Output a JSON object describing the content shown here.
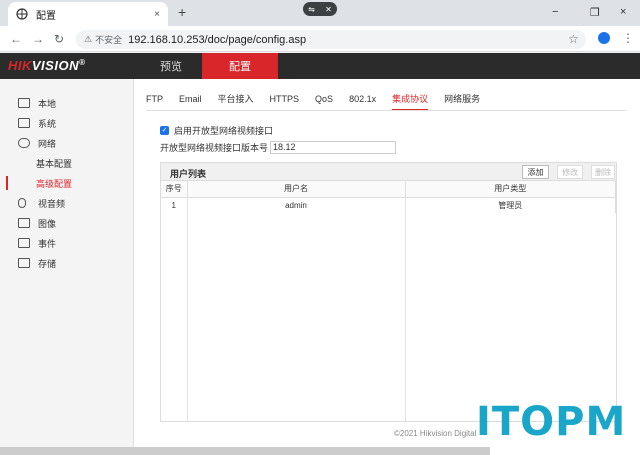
{
  "browser": {
    "tab_title": "配置",
    "tab_close": "×",
    "new_tab": "+",
    "window_minimize": "−",
    "window_restore": "❐",
    "window_close": "×",
    "insecure_label": "不安全",
    "url": "192.168.10.253/doc/page/config.asp"
  },
  "header": {
    "logo_hik": "HIK",
    "logo_vision": "VISION",
    "logo_reg": "®",
    "nav_preview": "预览",
    "nav_config": "配置"
  },
  "sidebar": {
    "items": [
      {
        "label": "本地",
        "icon": "monitor-icon"
      },
      {
        "label": "系统",
        "icon": "system-icon"
      },
      {
        "label": "网络",
        "icon": "globe-icon"
      },
      {
        "label": "基本配置"
      },
      {
        "label": "高级配置"
      },
      {
        "label": "视音频",
        "icon": "mic-icon"
      },
      {
        "label": "图像",
        "icon": "image-icon"
      },
      {
        "label": "事件",
        "icon": "event-icon"
      },
      {
        "label": "存储",
        "icon": "storage-icon"
      }
    ]
  },
  "tabs": [
    "FTP",
    "Email",
    "平台接入",
    "HTTPS",
    "QoS",
    "802.1x",
    "集成协议",
    "网络服务"
  ],
  "active_tab": "集成协议",
  "form": {
    "enable_label": "启用开放型网络视频接口",
    "enable_checked": true,
    "version_label": "开放型网络视频接口版本号",
    "version_value": "18.12"
  },
  "users": {
    "title": "用户列表",
    "add": "添加",
    "modify": "修改",
    "delete": "删除",
    "col_no": "序号",
    "col_name": "用户名",
    "col_type": "用户类型",
    "rows": [
      {
        "no": "1",
        "name": "admin",
        "type": "管理员"
      }
    ]
  },
  "footer": "©2021 Hikvision Digital",
  "watermark": "ITOPM",
  "colors": {
    "accent": "#d9262b",
    "header_bg": "#2b2b2b",
    "watermark": "#1aa6c8"
  }
}
